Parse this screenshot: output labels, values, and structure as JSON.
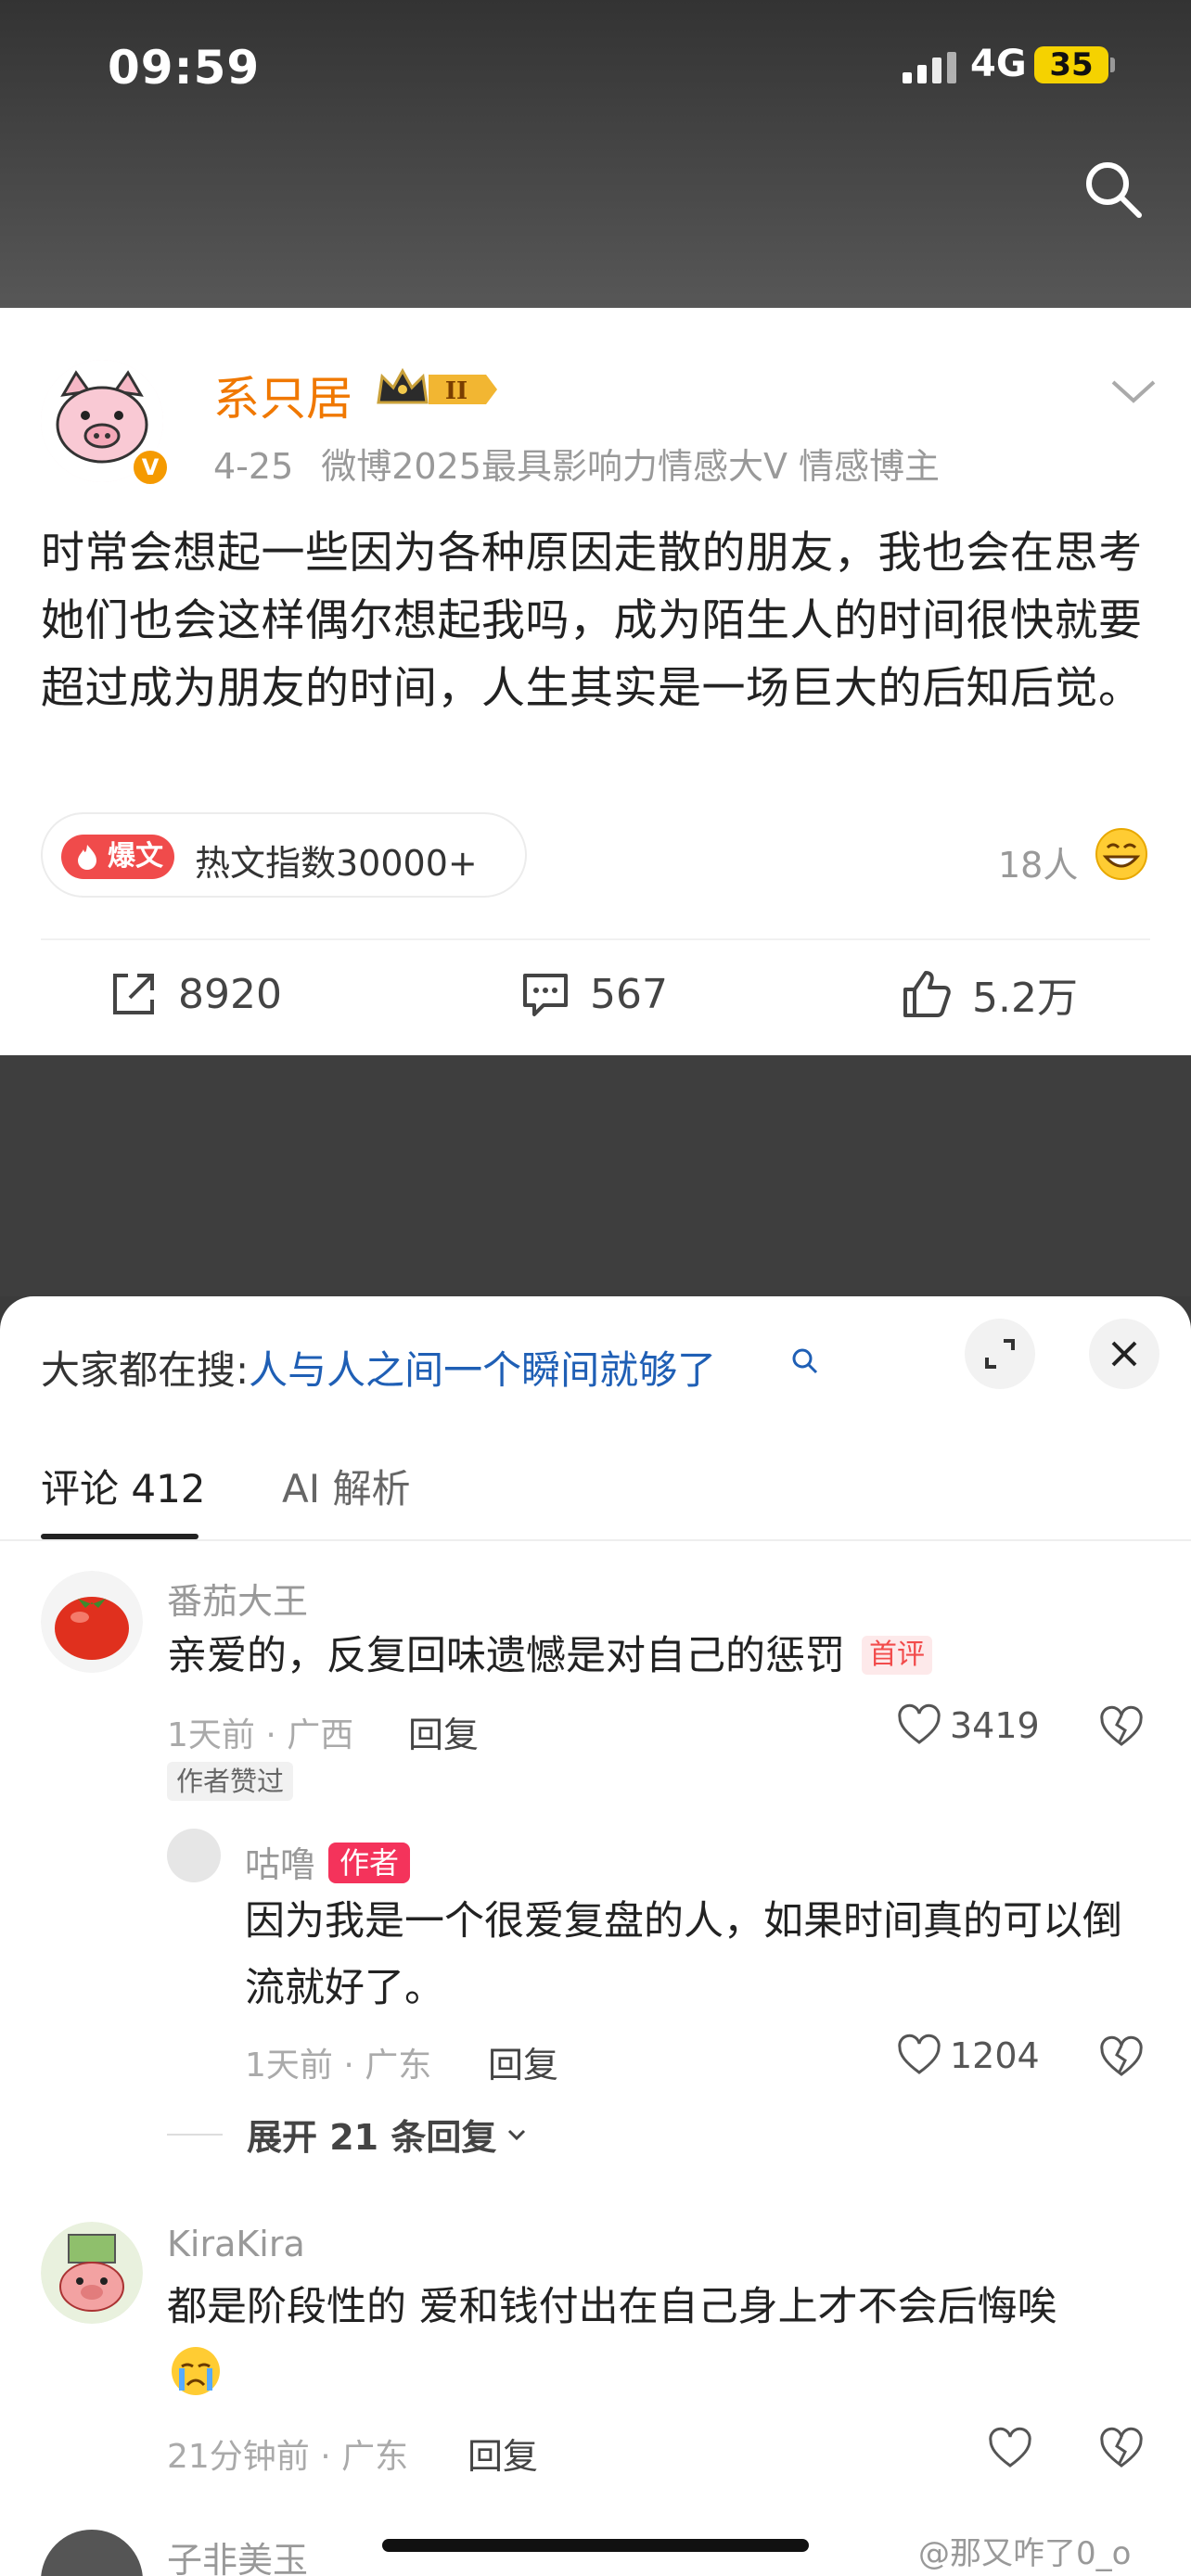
{
  "status_bar": {
    "time": "09:59",
    "network": "4G",
    "battery": "35"
  },
  "post": {
    "author": "系只居",
    "date": "4-25",
    "description": "微博2025最具影响力情感大V 情感博主",
    "text": "时常会想起一些因为各种原因走散的朋友，我也会在思考她们也会这样偶尔想起我吗，成为陌生人的时间很快就要超过成为朋友的时间，人生其实是一场巨大的后知后觉。",
    "hot_tag": "爆文",
    "hot_index": "热文指数30000+",
    "readers": "18人",
    "reposts": "8920",
    "comments": "567",
    "likes": "5.2万"
  },
  "sheet": {
    "search_prefix": "大家都在搜:",
    "search_term": "人与人之间一个瞬间就够了",
    "tabs": [
      {
        "label": "评论 412"
      },
      {
        "label": "AI 解析"
      }
    ]
  },
  "comments": [
    {
      "name": "番茄大王",
      "text": "亲爱的，反复回味遗憾是对自己的惩罚",
      "badge": "首评",
      "time_loc": "1天前 · 广西",
      "reply": "回复",
      "likes": "3419",
      "liked_by_author": "作者赞过"
    },
    {
      "name": "咕噜",
      "author_tag": "作者",
      "text": "因为我是一个很爱复盘的人，如果时间真的可以倒流就好了。",
      "time_loc": "1天前 · 广东",
      "reply": "回复",
      "likes": "1204"
    },
    {
      "expand": "展开 21 条回复"
    },
    {
      "name": "KiraKira",
      "text": "都是阶段性的 爱和钱付出在自己身上才不会后悔唉",
      "time_loc": "21分钟前 · 广东",
      "reply": "回复"
    },
    {
      "name": "子非美玉"
    }
  ],
  "watermark": "@那又咋了0_o"
}
